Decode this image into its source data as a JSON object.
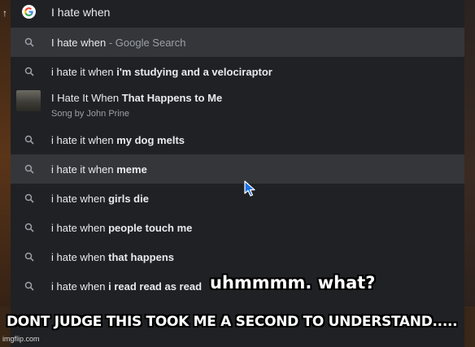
{
  "search": {
    "query": "I hate when",
    "logo_icon": "google-g-icon",
    "back_icon": "back-arrow-icon"
  },
  "suggestions": [
    {
      "prefix": "I hate when",
      "bold": "",
      "suffix": " - Google Search"
    },
    {
      "prefix": "i hate it when ",
      "bold": "i'm studying and a velociraptor",
      "suffix": ""
    },
    {
      "title_prefix": "I Hate It When ",
      "title_bold": "That Happens to Me",
      "subtitle": "Song by John Prine"
    },
    {
      "prefix": "i hate it when ",
      "bold": "my dog melts",
      "suffix": ""
    },
    {
      "prefix": "i hate it when ",
      "bold": "meme",
      "suffix": ""
    },
    {
      "prefix": "i hate when ",
      "bold": "girls die",
      "suffix": ""
    },
    {
      "prefix": "i hate when ",
      "bold": "people touch me",
      "suffix": ""
    },
    {
      "prefix": "i hate when ",
      "bold": "that happens",
      "suffix": ""
    },
    {
      "prefix": "i hate when ",
      "bold": "i read read as read",
      "suffix": ""
    }
  ],
  "captions": {
    "top": "uhmmmm. what?",
    "bottom": "DONT JUDGE THIS TOOK ME A SECOND TO UNDERSTAND....."
  },
  "watermark": "imgflip.com",
  "colors": {
    "panel": "#202124",
    "highlight": "#35363a",
    "text": "#e8eaed",
    "muted": "#9aa0a6"
  }
}
